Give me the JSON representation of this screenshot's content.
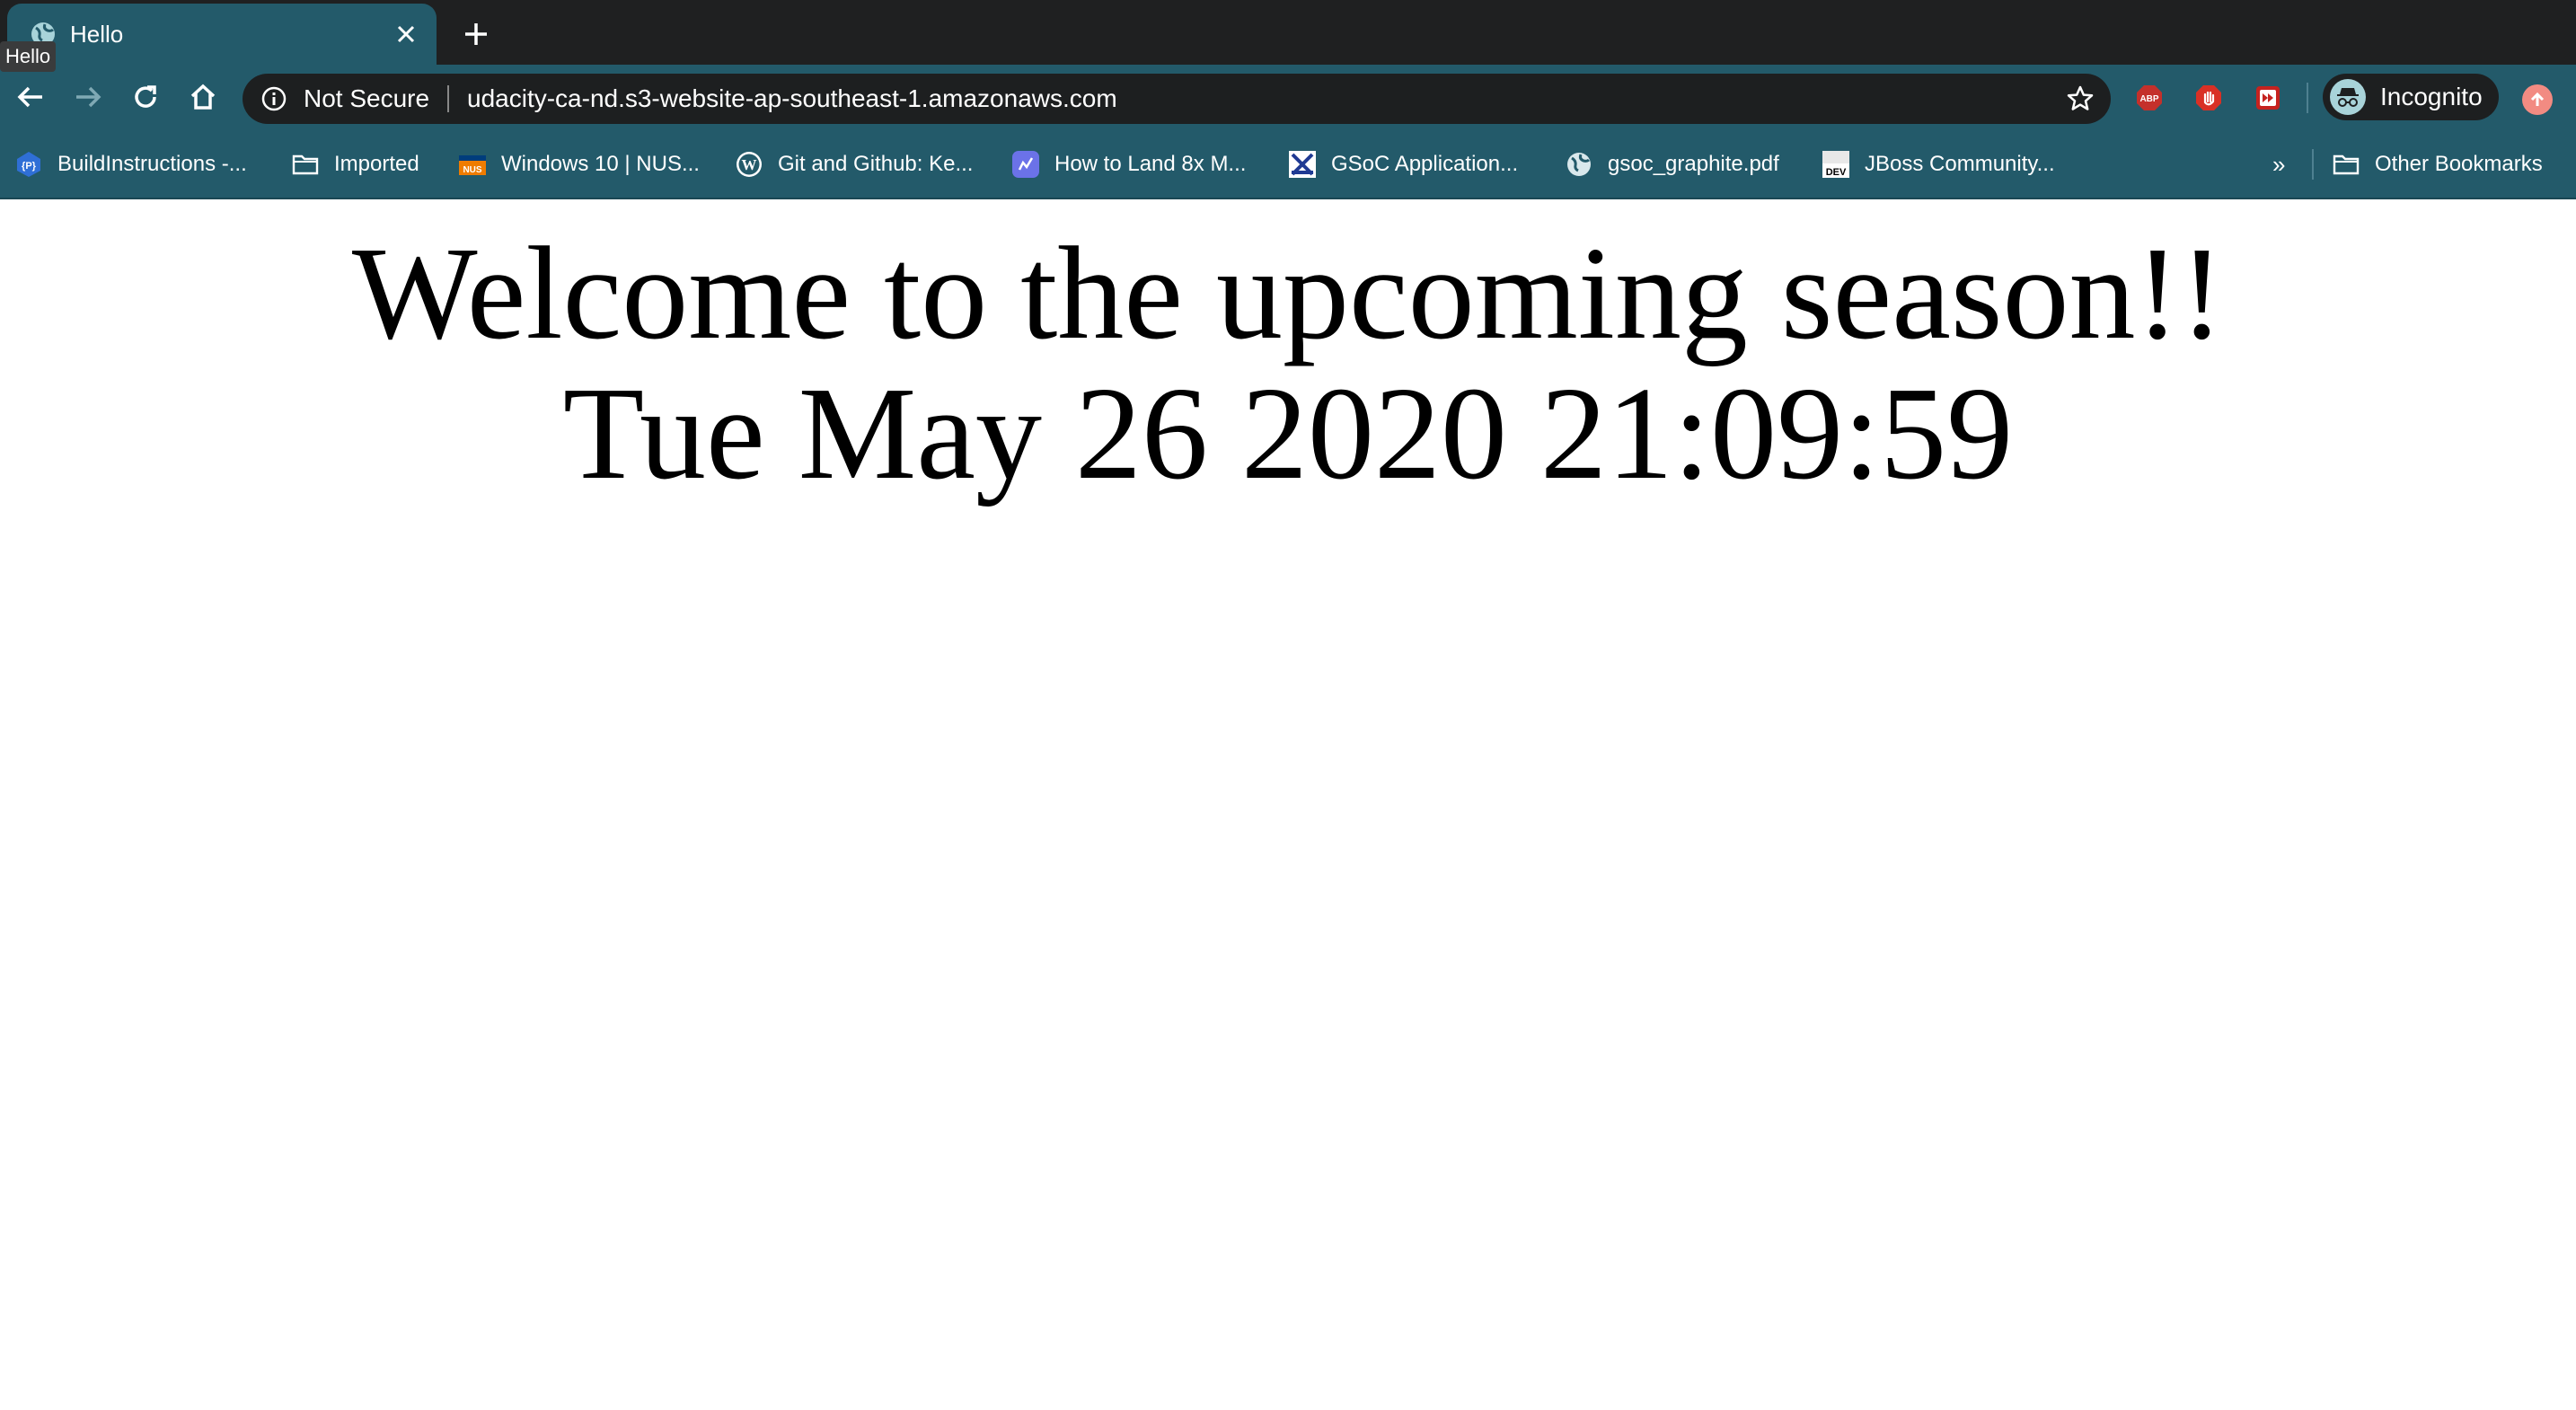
{
  "tab": {
    "title": "Hello",
    "tooltip": "Hello"
  },
  "omnibox": {
    "security_label": "Not Secure",
    "url": "udacity-ca-nd.s3-website-ap-southeast-1.amazonaws.com"
  },
  "profile": {
    "label": "Incognito"
  },
  "extensions": [
    {
      "name": "adblock-plus-icon",
      "label": "ABP"
    },
    {
      "name": "adblock-hand-icon"
    },
    {
      "name": "media-extension-icon"
    }
  ],
  "bookmarks": {
    "items": [
      {
        "label": "BuildInstructions -...",
        "icon": "pi-icon"
      },
      {
        "label": "Imported",
        "icon": "folder-icon"
      },
      {
        "label": "Windows 10 | NUS...",
        "icon": "nus-icon",
        "icon_text": "NUS"
      },
      {
        "label": "Git and Github: Ke...",
        "icon": "wordpress-icon"
      },
      {
        "label": "How to Land 8x M...",
        "icon": "medium-icon"
      },
      {
        "label": "GSoC Application...",
        "icon": "gsoc-icon"
      },
      {
        "label": "gsoc_graphite.pdf",
        "icon": "globe-icon"
      },
      {
        "label": "JBoss Community...",
        "icon": "jboss-icon",
        "icon_text": "DEV"
      }
    ],
    "overflow": "»",
    "other_label": "Other Bookmarks"
  },
  "page": {
    "heading": "Welcome to the upcoming season!!",
    "datetime": "Tue May 26 2020 21:09:59"
  },
  "colors": {
    "tab_strip": "#1f2021",
    "toolbar": "#235a6a",
    "omnibox": "#1d1f20"
  }
}
